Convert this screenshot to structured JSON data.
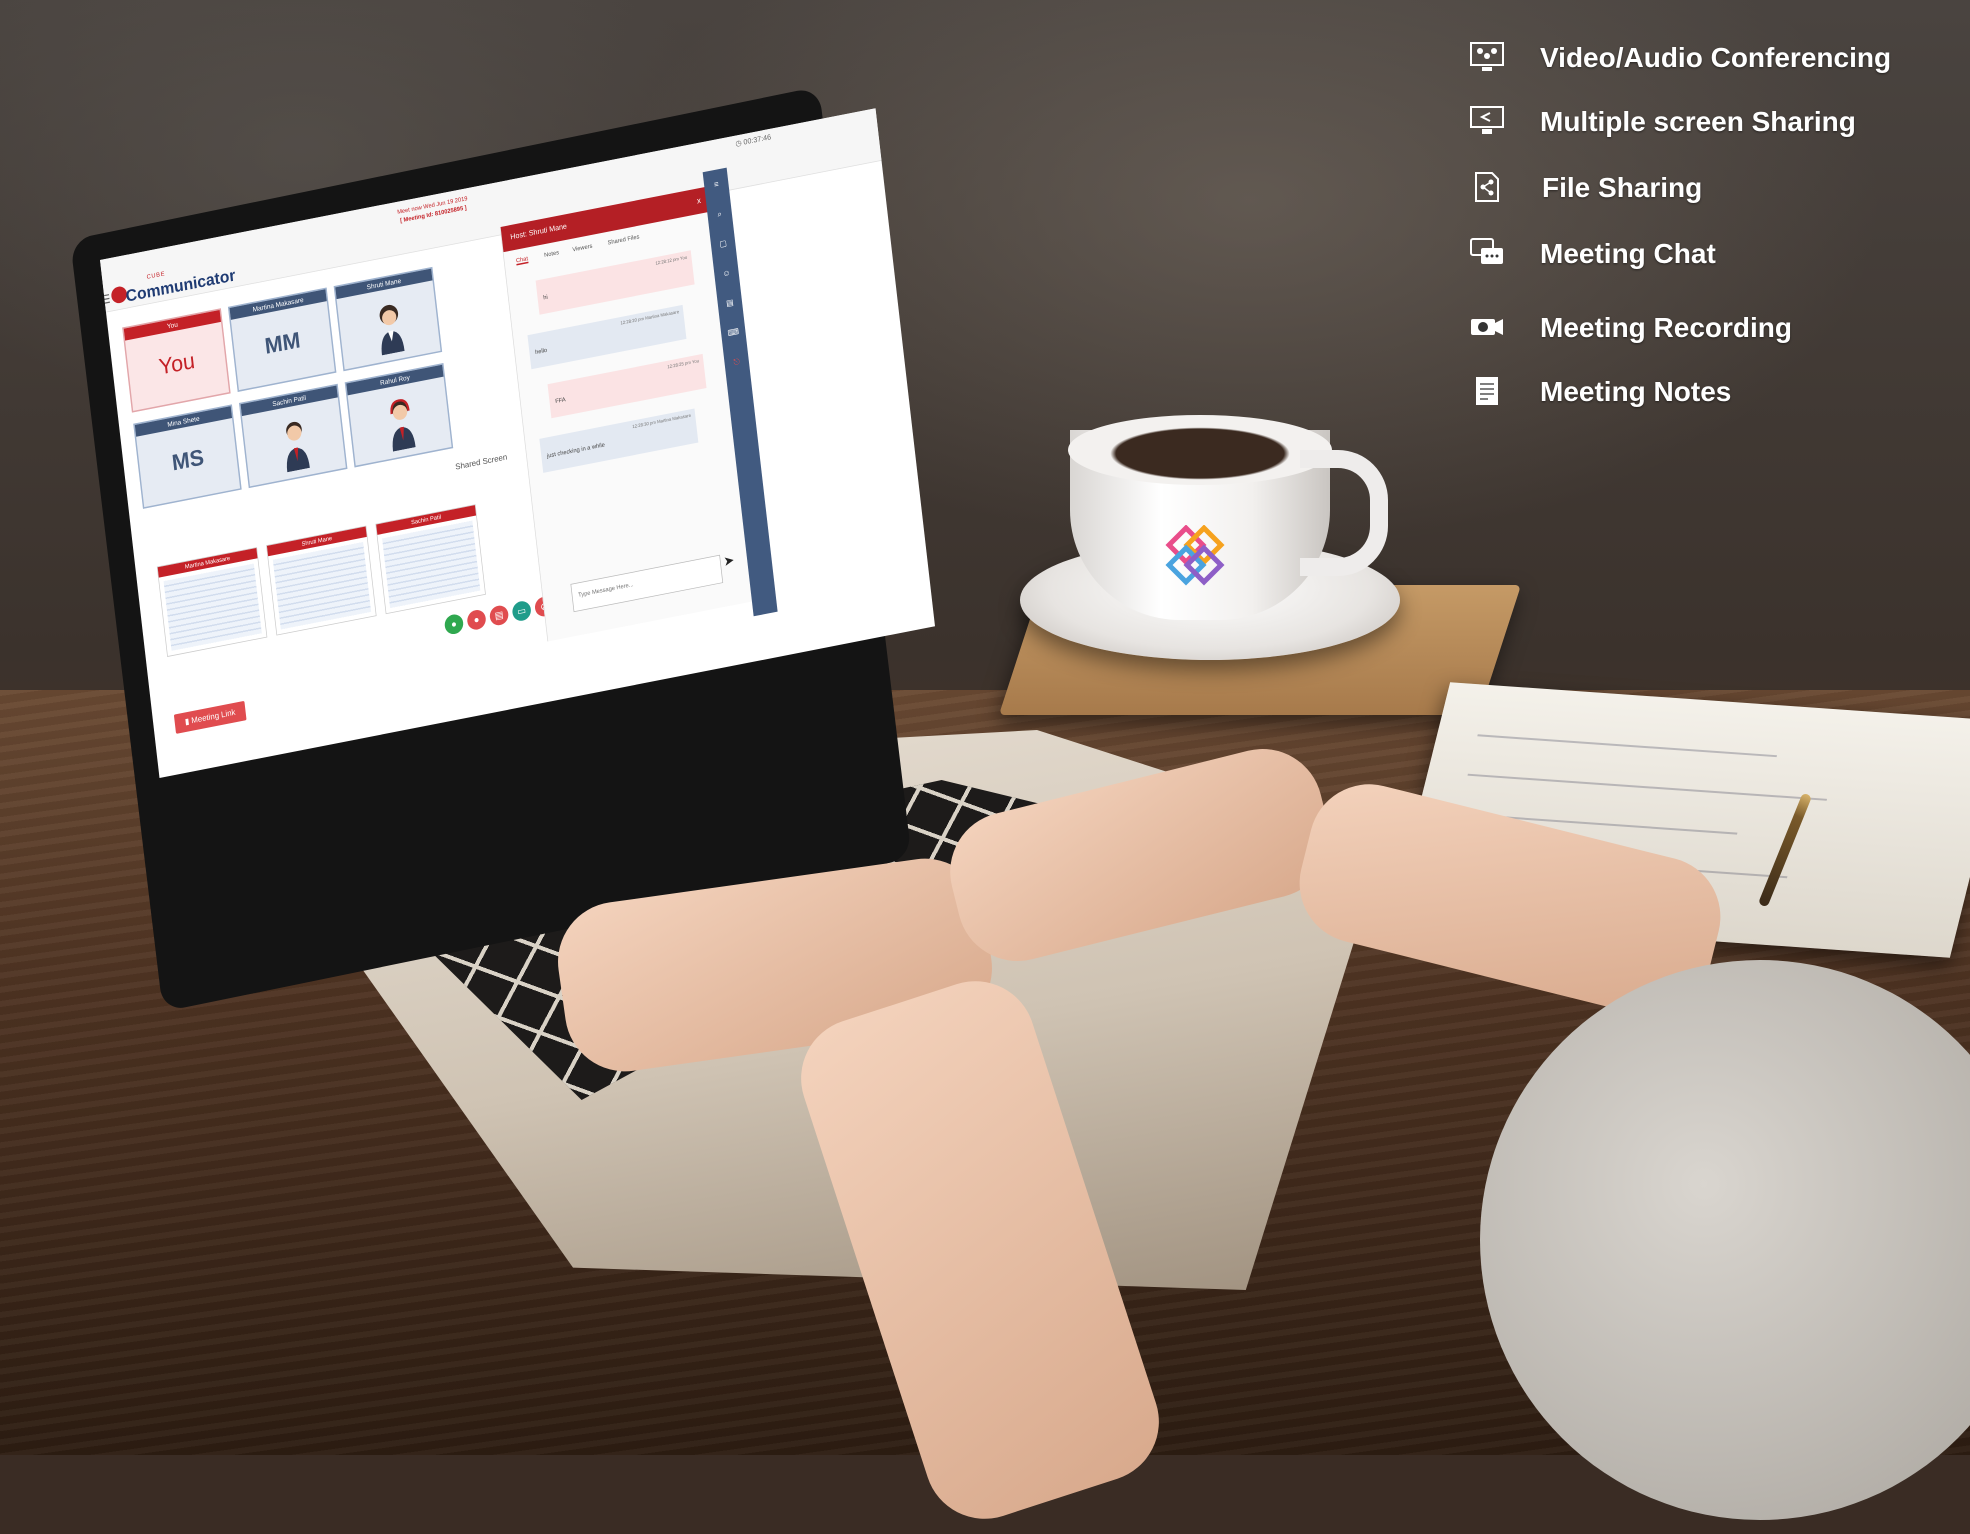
{
  "features": [
    {
      "label": "Video/Audio Conferencing",
      "icon": "video-conference-icon"
    },
    {
      "label": "Multiple screen Sharing",
      "icon": "screen-share-icon"
    },
    {
      "label": "File Sharing",
      "icon": "file-share-icon"
    },
    {
      "label": "Meeting Chat",
      "icon": "chat-icon"
    },
    {
      "label": "Meeting Recording",
      "icon": "camera-icon"
    },
    {
      "label": "Meeting Notes",
      "icon": "notes-icon"
    }
  ],
  "app": {
    "brand_small": "CUBE",
    "brand_name": "Communicator",
    "meet_now": "Meet now Wed Jun 19 2019",
    "meeting_id": "[ Meeting Id: 810025895 ]",
    "timer": "00:37:46",
    "participants": [
      {
        "caption": "You",
        "initials": "You",
        "avatar": "text"
      },
      {
        "caption": "Martina Makasare",
        "initials": "MM",
        "avatar": "text"
      },
      {
        "caption": "Shruti Mane",
        "initials": "",
        "avatar": "female-avatar-icon"
      },
      {
        "caption": "Mina Shete",
        "initials": "MS",
        "avatar": "text"
      },
      {
        "caption": "Sachin Patil",
        "initials": "",
        "avatar": "male-avatar-icon"
      },
      {
        "caption": "Rahul Roy",
        "initials": "",
        "avatar": "headset-avatar-icon"
      }
    ],
    "shared_screen_label": "Shared Screen",
    "shared_screens": [
      {
        "caption": "Martina Makasare"
      },
      {
        "caption": "Shruti Mane"
      },
      {
        "caption": "Sachin Patil"
      }
    ],
    "meeting_link_label": "Meeting Link",
    "chat": {
      "host_label": "Host: Shruti Mane",
      "close": "x",
      "tabs": [
        "Chat",
        "Notes",
        "Viewers",
        "Shared Files"
      ],
      "messages": [
        {
          "text": "hi",
          "meta": "12:28:12 pm  You",
          "from": "me"
        },
        {
          "text": "hello",
          "meta": "12:28:20 pm  Martina Makasare",
          "from": "other"
        },
        {
          "text": "FFA",
          "meta": "12:28:25 pm  You",
          "from": "me"
        },
        {
          "text": "just checking in a while",
          "meta": "12:28:30 pm  Martina Makasare",
          "from": "other"
        }
      ],
      "input_placeholder": "Type Message Here..."
    }
  },
  "colors": {
    "brand_red": "#c42127",
    "brand_navy": "#3f5577",
    "rail_blue": "#415a80",
    "feature_text": "#ffffff"
  }
}
